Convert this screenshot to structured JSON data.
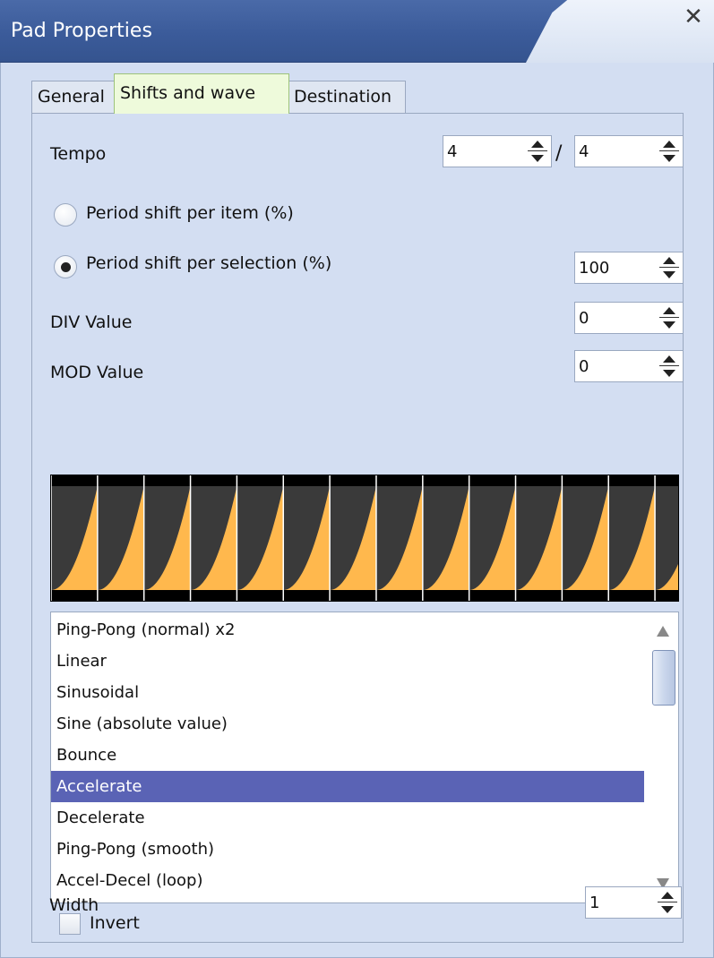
{
  "window": {
    "title": "Pad Properties",
    "close_glyph": "✕"
  },
  "tabs": [
    {
      "label": "General",
      "active": false
    },
    {
      "label": "Shifts and wave",
      "active": true
    },
    {
      "label": "Destination",
      "active": false
    }
  ],
  "tempo": {
    "label": "Tempo",
    "numerator": "4",
    "separator": "/",
    "denominator": "4"
  },
  "period_shift_item": {
    "label": "Period shift per item (%)",
    "selected": false
  },
  "period_shift_selection": {
    "label": "Period shift per selection (%)",
    "selected": true,
    "value": "100"
  },
  "div": {
    "label": "DIV Value",
    "value": "0"
  },
  "mod": {
    "label": "MOD Value",
    "value": "0"
  },
  "waveform": {
    "shape": "accelerate",
    "cycles": 13.5,
    "fill_color": "#ffb84d",
    "bg_color": "#3a3a3a"
  },
  "wave_list": {
    "items": [
      "Ping-Pong (normal) x2",
      "Linear",
      "Sinusoidal",
      "Sine (absolute value)",
      "Bounce",
      "Accelerate",
      "Decelerate",
      "Ping-Pong (smooth)",
      "Accel-Decel (loop)"
    ],
    "selected_index": 5,
    "selection_color": "#5a63b5"
  },
  "invert": {
    "label": "Invert",
    "checked": false
  },
  "width": {
    "label": "Width",
    "value": "1"
  }
}
